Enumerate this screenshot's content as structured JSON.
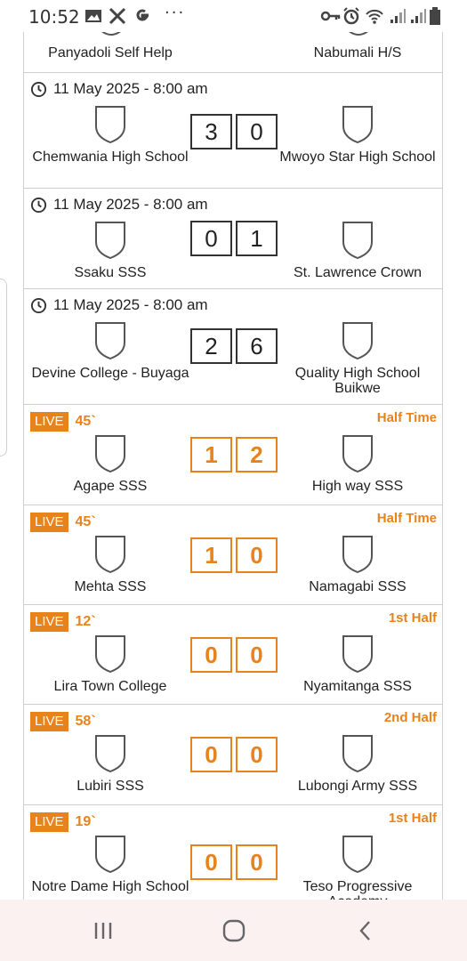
{
  "status_bar": {
    "time": "10:52",
    "overflow": "···",
    "icons": [
      "gallery-icon",
      "x-icon",
      "google-icon",
      "key-icon",
      "alarm-icon",
      "wifi-icon",
      "signal-icon",
      "signal-icon",
      "battery-icon"
    ]
  },
  "partial_top": {
    "home": "Panyadoli Self Help",
    "away": "Nabumali H/S"
  },
  "scheduled": [
    {
      "time": "11 May 2025 - 8:00 am",
      "home": "Chemwania High School",
      "away": "Mwoyo Star High School",
      "home_score": "3",
      "away_score": "0"
    },
    {
      "time": "11 May 2025 - 8:00 am",
      "home": "Ssaku SSS",
      "away": "St. Lawrence Crown",
      "home_score": "0",
      "away_score": "1"
    },
    {
      "time": "11 May 2025 - 8:00 am",
      "home": "Devine College - Buyaga",
      "away": "Quality High School Buikwe",
      "home_score": "2",
      "away_score": "6"
    }
  ],
  "live": [
    {
      "badge": "LIVE",
      "minute": "45`",
      "status": "Half Time",
      "home": "Agape SSS",
      "away": "High way SSS",
      "home_score": "1",
      "away_score": "2"
    },
    {
      "badge": "LIVE",
      "minute": "45`",
      "status": "Half Time",
      "home": "Mehta SSS",
      "away": "Namagabi SSS",
      "home_score": "1",
      "away_score": "0"
    },
    {
      "badge": "LIVE",
      "minute": "12`",
      "status": "1st Half",
      "home": "Lira Town College",
      "away": "Nyamitanga SSS",
      "home_score": "0",
      "away_score": "0"
    },
    {
      "badge": "LIVE",
      "minute": "58`",
      "status": "2nd Half",
      "home": "Lubiri SSS",
      "away": "Lubongi Army SSS",
      "home_score": "0",
      "away_score": "0"
    },
    {
      "badge": "LIVE",
      "minute": "19`",
      "status": "1st Half",
      "home": "Notre Dame High School",
      "away": "Teso Progressive Academy",
      "home_score": "0",
      "away_score": "0"
    }
  ],
  "colors": {
    "accent": "#e8821a",
    "border": "#cfcfcf",
    "nav_bg": "#fbf1f1"
  },
  "nav": [
    "recent-apps-icon",
    "home-icon",
    "back-icon"
  ]
}
